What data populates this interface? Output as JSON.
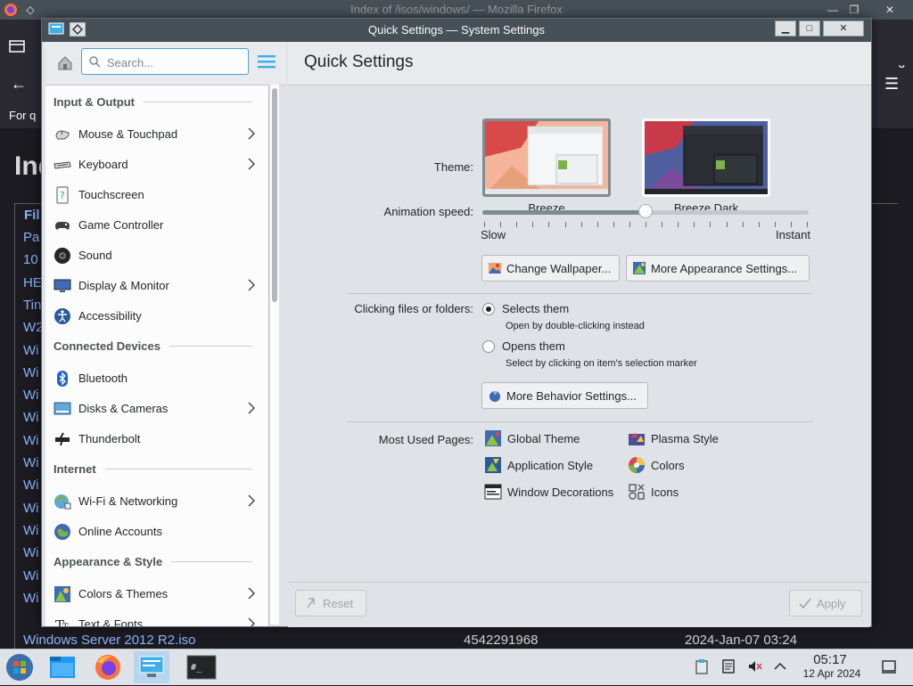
{
  "firefox": {
    "title": "Index of /isos/windows/ — Mozilla Firefox",
    "bookmark_text": "For q",
    "page_heading": "Ind",
    "header_cell": "Fil",
    "rows": [
      "Pa",
      "10",
      "HE",
      "Tin",
      "W2",
      "Wi",
      "Wi",
      "Wi",
      "Wi",
      "Wi",
      "Wi",
      "Wi",
      "Wi",
      "Wi",
      "Wi",
      "Wi",
      "Wi"
    ],
    "last_row": {
      "name": "Windows Server 2012 R2.iso",
      "size": "4542291968",
      "date": "2024-Jan-07 03:24"
    }
  },
  "window": {
    "title": "Quick Settings — System Settings",
    "minimize": "▁",
    "maximize": "□",
    "close": "✕"
  },
  "sidebar": {
    "search_placeholder": "Search...",
    "groups": [
      {
        "label": "Input & Output",
        "items": [
          {
            "label": "Mouse & Touchpad",
            "icon": "mouse-icon",
            "chevron": true
          },
          {
            "label": "Keyboard",
            "icon": "keyboard-icon",
            "chevron": true
          },
          {
            "label": "Touchscreen",
            "icon": "touchscreen-icon",
            "chevron": false
          },
          {
            "label": "Game Controller",
            "icon": "gamepad-icon",
            "chevron": false
          },
          {
            "label": "Sound",
            "icon": "speaker-icon",
            "chevron": false
          },
          {
            "label": "Display & Monitor",
            "icon": "monitor-icon",
            "chevron": true
          },
          {
            "label": "Accessibility",
            "icon": "accessibility-icon",
            "chevron": false
          }
        ]
      },
      {
        "label": "Connected Devices",
        "items": [
          {
            "label": "Bluetooth",
            "icon": "bluetooth-icon",
            "chevron": false
          },
          {
            "label": "Disks & Cameras",
            "icon": "disk-icon",
            "chevron": true
          },
          {
            "label": "Thunderbolt",
            "icon": "thunderbolt-icon",
            "chevron": false
          }
        ]
      },
      {
        "label": "Internet",
        "items": [
          {
            "label": "Wi-Fi & Networking",
            "icon": "network-icon",
            "chevron": true
          },
          {
            "label": "Online Accounts",
            "icon": "online-accounts-icon",
            "chevron": false
          }
        ]
      },
      {
        "label": "Appearance & Style",
        "items": [
          {
            "label": "Colors & Themes",
            "icon": "colors-themes-icon",
            "chevron": true
          },
          {
            "label": "Text & Fonts",
            "icon": "fonts-icon",
            "chevron": true
          }
        ]
      }
    ]
  },
  "main": {
    "page_title": "Quick Settings",
    "theme_label": "Theme:",
    "themes": [
      {
        "name": "Breeze",
        "selected": true
      },
      {
        "name": "Breeze Dark",
        "selected": false
      }
    ],
    "animation_label": "Animation speed:",
    "animation_min": "Slow",
    "animation_max": "Instant",
    "animation_value": 0.5,
    "change_wallpaper": "Change Wallpaper...",
    "more_appearance": "More Appearance Settings...",
    "clicking_label": "Clicking files or folders:",
    "radio_select": "Selects them",
    "radio_select_sub": "Open by double-clicking instead",
    "radio_open": "Opens them",
    "radio_open_sub": "Select by clicking on item's selection marker",
    "more_behavior": "More Behavior Settings...",
    "most_used_label": "Most Used Pages:",
    "most_used": [
      {
        "label": "Global Theme",
        "icon": "global-theme-icon"
      },
      {
        "label": "Plasma Style",
        "icon": "plasma-style-icon"
      },
      {
        "label": "Application Style",
        "icon": "application-style-icon"
      },
      {
        "label": "Colors",
        "icon": "colors-icon"
      },
      {
        "label": "Window Decorations",
        "icon": "window-decorations-icon"
      },
      {
        "label": "Icons",
        "icon": "icons-icon"
      }
    ],
    "reset": "Reset",
    "apply": "Apply"
  },
  "taskbar": {
    "time": "05:17",
    "date": "12 Apr 2024",
    "apps": [
      "start-menu-icon",
      "file-manager-icon",
      "firefox-icon",
      "system-settings-icon",
      "terminal-icon"
    ]
  },
  "colors": {
    "accent": "#3daee9",
    "titlebar": "#475057",
    "window": "#eff0f1"
  }
}
